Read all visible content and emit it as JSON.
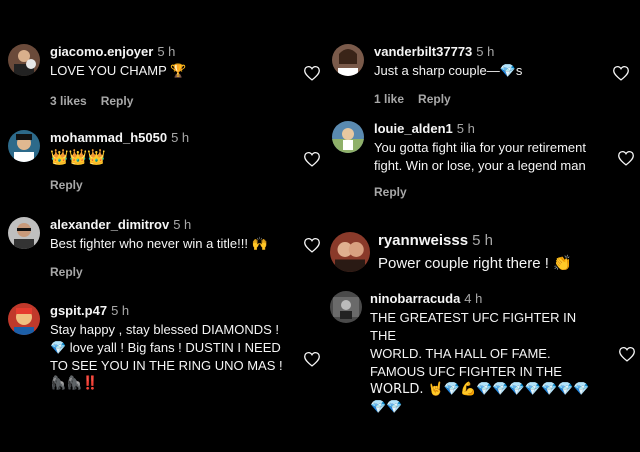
{
  "left_comments": [
    {
      "username": "giacomo.enjoyer",
      "time": "5 h",
      "text": "LOVE YOU CHAMP 🏆",
      "likes_label": "3 likes",
      "reply_label": "Reply",
      "avatar_color": "#6a4a3a"
    },
    {
      "username": "mohammad_h5050",
      "time": "5 h",
      "text": "👑👑👑",
      "likes_label": "",
      "reply_label": "Reply",
      "avatar_color": "#2d6a8a"
    },
    {
      "username": "alexander_dimitrov",
      "time": "5 h",
      "text": "Best fighter who never win a title!!! 🙌",
      "likes_label": "",
      "reply_label": "Reply",
      "avatar_color": "#3a3a3a"
    },
    {
      "username": "gspit.p47",
      "time": "5 h",
      "text_lines": [
        "Stay happy , stay blessed DIAMONDS !",
        "💎 love yall ! Big fans ! DUSTIN I NEED",
        "TO SEE YOU IN THE RING UNO MAS !",
        "🦍🦍‼️"
      ],
      "likes_label": "",
      "reply_label": "",
      "avatar_color": "#c0392b"
    }
  ],
  "right_comments": [
    {
      "username": "vanderbilt37773",
      "time": "5 h",
      "text": "Just a sharp couple—💎s",
      "likes_label": "1 like",
      "reply_label": "Reply",
      "avatar_color": "#7a5a4a"
    },
    {
      "username": "louie_alden1",
      "time": "5 h",
      "text_lines": [
        "You gotta fight ilia for your retirement",
        "fight. Win or lose, your a legend man"
      ],
      "likes_label": "",
      "reply_label": "Reply",
      "avatar_color": "#5a8ab0"
    },
    {
      "username": "ryannweisss",
      "time": "5 h",
      "text": "Power couple right there ! 👏",
      "likes_label": "",
      "reply_label": "",
      "avatar_color": "#8a3a2a"
    },
    {
      "username": "ninobarracuda",
      "time": "4 h",
      "text_lines": [
        "THE GREATEST UFC FIGHTER IN THE",
        "WORLD. THA HALL OF FAME.",
        "FAMOUS UFC FIGHTER IN THE",
        "WORLD. 🤘💎💪💎💎💎💎💎💎💎",
        "💎💎"
      ],
      "likes_label": "",
      "reply_label": "",
      "avatar_color": "#4a4a4a"
    }
  ]
}
